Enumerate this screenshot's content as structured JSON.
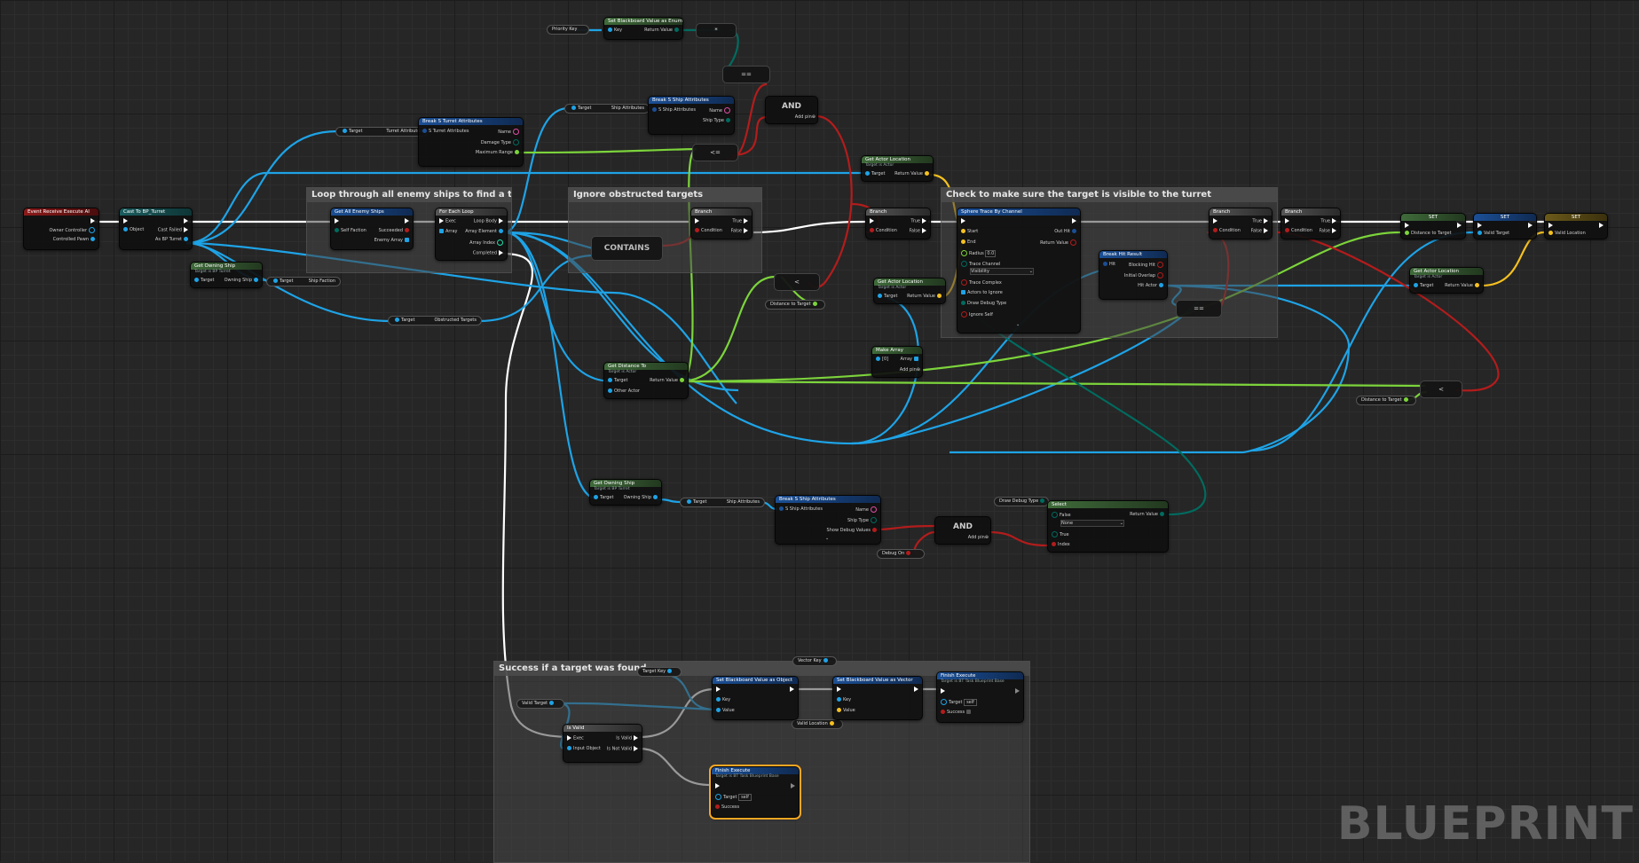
{
  "watermark": "BLUEPRINT",
  "comments": {
    "loop": "Loop through all enemy ships to find a target",
    "ignore": "Ignore obstructed targets",
    "check": "Check to make sure the target is visible to the turret",
    "success": "Success if a target was found"
  },
  "colors": {
    "exec": "#ffffff",
    "object": "#1ea3e6",
    "boolean": "#b31c1c",
    "float": "#7cd43b",
    "vector": "#f6c120",
    "name": "#e04ea4",
    "struct": "#1b4f95",
    "byte": "#006b5f"
  },
  "nodes": {
    "event": {
      "title": "Event Receive Execute AI",
      "owner": "Owner Controller",
      "pawn": "Controlled Pawn"
    },
    "cast": {
      "title": "Cast To BP_Turret",
      "object": "Object",
      "failed": "Cast Failed",
      "as": "As BP Turret"
    },
    "get_owning_ship_1": {
      "title": "Get Owning Ship",
      "sub": "Target is BP Turret",
      "target": "Target",
      "out": "Owning Ship"
    },
    "ship_faction": {
      "target": "Target",
      "out": "Ship Faction"
    },
    "turret_attr_var": {
      "target": "Target",
      "out": "Turret Attributes"
    },
    "break_turret": {
      "title": "Break S Turret Attributes",
      "in": "S Turret Attributes",
      "name": "Name",
      "damage": "Damage Type",
      "range": "Maximum Range"
    },
    "get_all_enemy": {
      "title": "Get All Enemy Ships",
      "self": "Self Faction",
      "succeeded": "Succeeded",
      "enemy": "Enemy Array"
    },
    "foreach": {
      "title": "For Each Loop",
      "exec": "Exec",
      "array": "Array",
      "body": "Loop Body",
      "element": "Array Element",
      "index": "Array Index",
      "completed": "Completed"
    },
    "obstructed": {
      "target": "Target",
      "out": "Obstructed Targets"
    },
    "contains": {
      "title": "CONTAINS"
    },
    "ship_attr_var1": {
      "target": "Target",
      "out": "Ship Attributes"
    },
    "break_ship1": {
      "title": "Break S Ship Attributes",
      "in": "S Ship Attributes",
      "name": "Name",
      "type": "Ship Type"
    },
    "priority_key": {
      "label": "Priority Key"
    },
    "get_bb_enum": {
      "title": "Set Blackboard Value as Enum",
      "key": "Key",
      "ret": "Return Value"
    },
    "and1": {
      "title": "AND",
      "add": "Add pin"
    },
    "branch1": {
      "title": "Branch",
      "cond": "Condition",
      "t": "True",
      "f": "False"
    },
    "branch2": {
      "title": "Branch",
      "cond": "Condition",
      "t": "True",
      "f": "False"
    },
    "branch3": {
      "title": "Branch",
      "cond": "Condition",
      "t": "True",
      "f": "False"
    },
    "branch4": {
      "title": "Branch",
      "cond": "Condition",
      "t": "True",
      "f": "False"
    },
    "get_actor_loc1": {
      "title": "Get Actor Location",
      "sub": "Target is Actor",
      "target": "Target",
      "ret": "Return Value"
    },
    "get_actor_loc2": {
      "title": "Get Actor Location",
      "sub": "Target is Actor",
      "target": "Target",
      "ret": "Return Value"
    },
    "get_actor_loc3": {
      "title": "Get Actor Location",
      "sub": "Target is Actor",
      "target": "Target",
      "ret": "Return Value"
    },
    "distance_to_target_a": {
      "label": "Distance to Target"
    },
    "distance_to_target_b": {
      "label": "Distance to Target"
    },
    "get_distance_to": {
      "title": "Get Distance To",
      "sub": "Target is Actor",
      "target": "Target",
      "other": "Other Actor",
      "ret": "Return Value"
    },
    "make_array": {
      "title": "Make Array",
      "idx": "[0]",
      "array": "Array",
      "add": "Add pin"
    },
    "sphere_trace": {
      "title": "Sphere Trace By Channel",
      "start": "Start",
      "end": "End",
      "radius": "Radius",
      "radius_val": "0.0",
      "channel": "Trace Channel",
      "channel_val": "Visibility",
      "complex": "Trace Complex",
      "ignore": "Actors to Ignore",
      "debug": "Draw Debug Type",
      "self": "Ignore Self",
      "outhit": "Out Hit",
      "ret": "Return Value"
    },
    "break_hit": {
      "title": "Break Hit Result",
      "hit": "Hit",
      "blocking": "Blocking Hit",
      "initial": "Initial Overlap",
      "hitactor": "Hit Actor"
    },
    "set1": {
      "title": "SET",
      "pin": "Distance to Target"
    },
    "set2": {
      "title": "SET",
      "pin": "Valid Target"
    },
    "set3": {
      "title": "SET",
      "pin": "Valid Location"
    },
    "get_owning_ship_2": {
      "title": "Get Owning Ship",
      "sub": "Target is BP Turret",
      "target": "Target",
      "out": "Owning Ship"
    },
    "ship_attr_var2": {
      "target": "Target",
      "out": "Ship Attributes"
    },
    "break_ship2": {
      "title": "Break S Ship Attributes",
      "in": "S Ship Attributes",
      "name": "Name",
      "type": "Ship Type",
      "debug": "Show Debug Values"
    },
    "and2": {
      "title": "AND",
      "add": "Add pin"
    },
    "debug_on": {
      "label": "Debug On"
    },
    "draw_debug_var": {
      "label": "Draw Debug Type"
    },
    "select": {
      "title": "Select",
      "false": "False",
      "false_val": "None",
      "true": "True",
      "index": "Index",
      "ret": "Return Value"
    },
    "target_key": {
      "label": "Target Key"
    },
    "vector_key": {
      "label": "Vector Key"
    },
    "valid_target": {
      "label": "Valid Target"
    },
    "valid_location": {
      "label": "Valid Location"
    },
    "is_valid": {
      "title": "Is Valid",
      "exec": "Exec",
      "input": "Input Object",
      "valid": "Is Valid",
      "notvalid": "Is Not Valid"
    },
    "set_bb_object": {
      "title": "Set Blackboard Value as Object",
      "key": "Key",
      "value": "Value"
    },
    "set_bb_vector": {
      "title": "Set Blackboard Value as Vector",
      "key": "Key",
      "value": "Value"
    },
    "finish1": {
      "title": "Finish Execute",
      "sub": "Target is BT Task Blueprint Base",
      "target": "Target",
      "self": "self",
      "success": "Success"
    },
    "finish2": {
      "title": "Finish Execute",
      "sub": "Target is BT Task Blueprint Base",
      "target": "Target",
      "self": "self",
      "success": "Success"
    },
    "compare_eq1": {
      "symbol": "=="
    },
    "compare_eq2": {
      "symbol": "=="
    },
    "compare_le": {
      "symbol": "<="
    },
    "compare_lt1": {
      "symbol": "<"
    },
    "compare_lt2": {
      "symbol": "<"
    },
    "multiply": {
      "symbol": "*"
    }
  }
}
